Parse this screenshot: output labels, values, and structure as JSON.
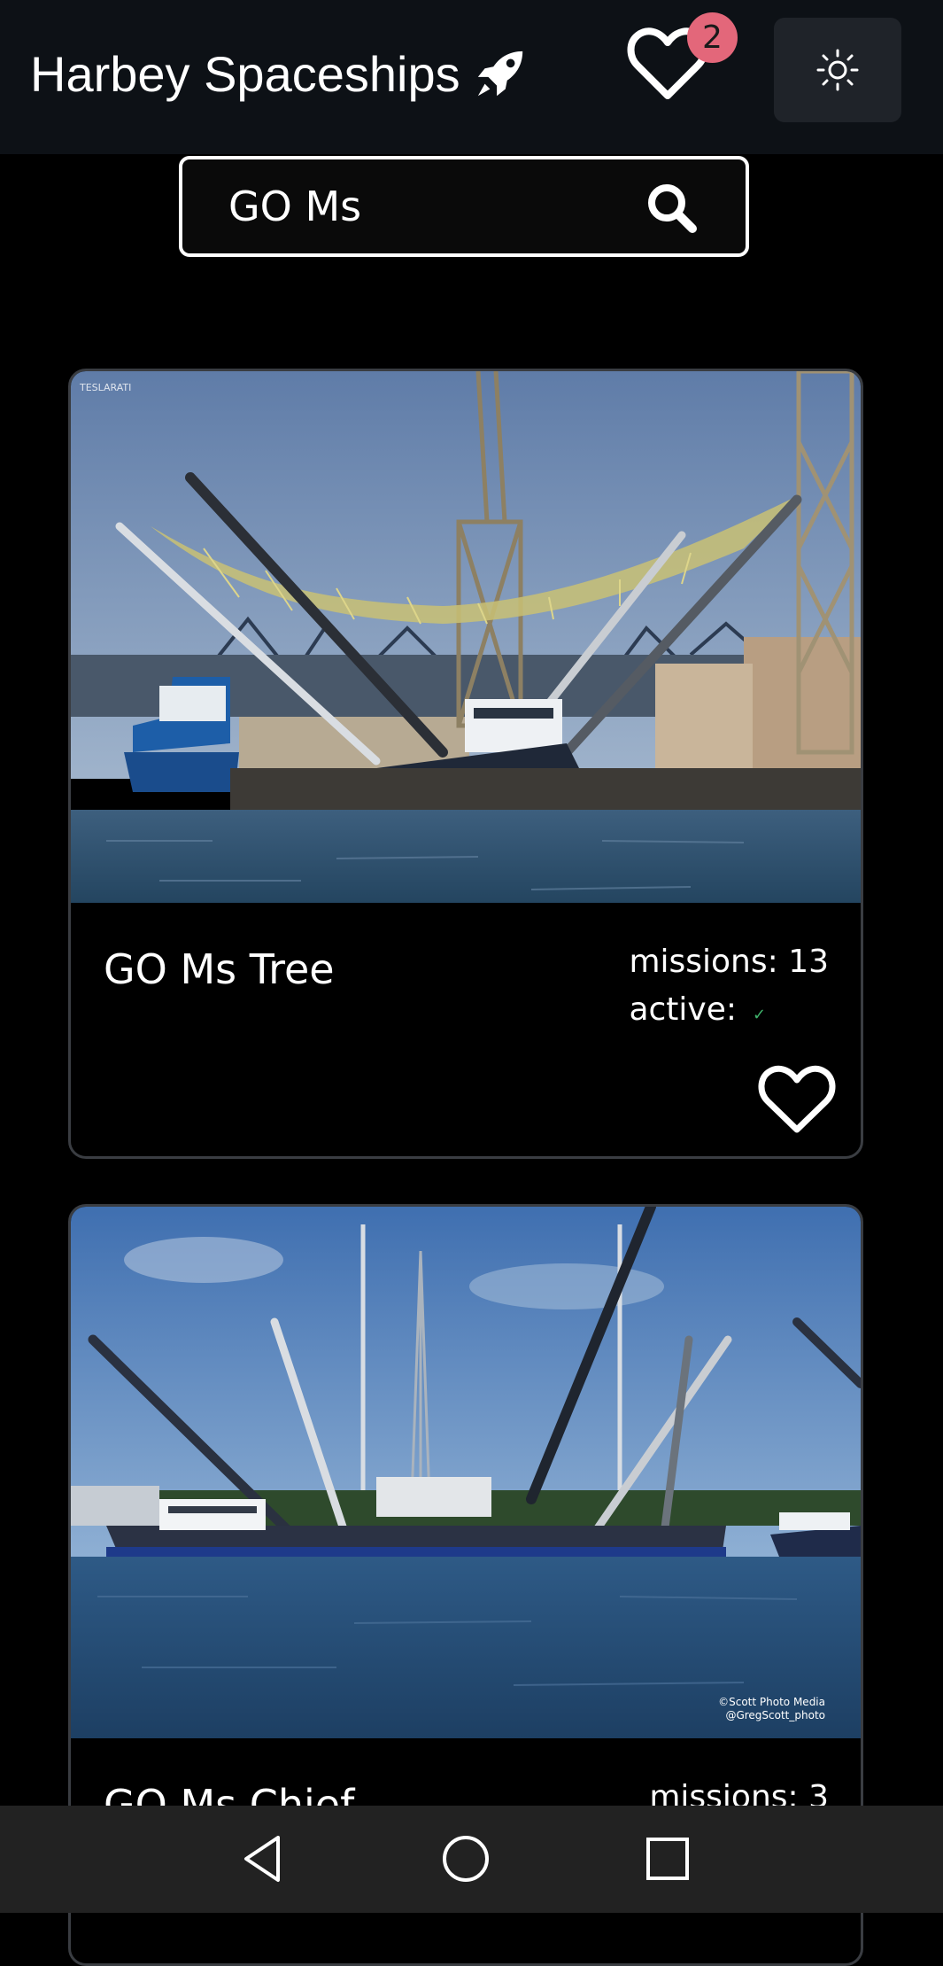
{
  "header": {
    "title": "Harbey Spaceships",
    "favorites_count": "2",
    "brand_icon": "rocket-icon",
    "favorites_icon": "heart-outline-icon",
    "theme_icon": "sun-icon"
  },
  "search": {
    "value": "GO Ms",
    "icon": "search-icon"
  },
  "ships": [
    {
      "name": "GO Ms Tree",
      "missions_label": "missions: 13",
      "active_label": "active:",
      "active_mark": "✓",
      "image": "ship-photo-go-ms-tree",
      "watermark": "TESLARATI"
    },
    {
      "name": "GO Ms Chief",
      "missions_label": "missions: 3",
      "image": "ship-photo-go-ms-chief",
      "watermark_line1": "©Scott Photo Media",
      "watermark_line2": "@GregScott_photo"
    }
  ],
  "navbar": {
    "back": "back-triangle-icon",
    "home": "home-circle-icon",
    "recents": "recents-square-icon"
  },
  "colors": {
    "header_bg": "#0d1116",
    "badge": "#e3677a",
    "active_check": "#3fb36b",
    "theme_btn_bg": "#1f2329"
  }
}
